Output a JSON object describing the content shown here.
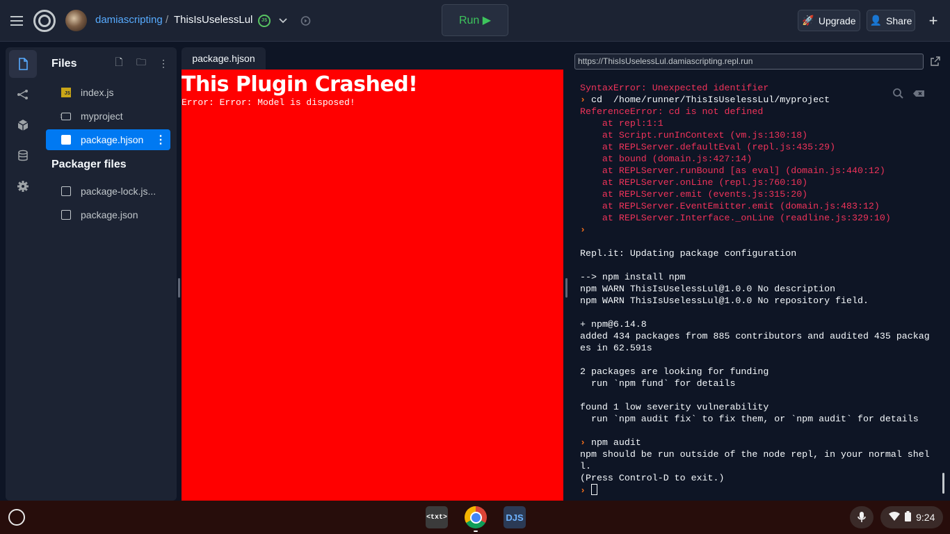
{
  "topbar": {
    "owner": "damiascripting",
    "separator": "/",
    "repl_name": "ThisIsUselessLul",
    "lang_badge": "JS",
    "run_label": "Run ▶",
    "upgrade_label": "Upgrade",
    "share_label": "Share",
    "plus_label": "+"
  },
  "sidebar": {
    "files_title": "Files",
    "packager_title": "Packager files",
    "files": [
      {
        "label": "index.js",
        "type": "js"
      },
      {
        "label": "myproject",
        "type": "folder"
      },
      {
        "label": "package.hjson",
        "type": "file",
        "selected": true
      }
    ],
    "packager_files": [
      {
        "label": "package-lock.js..."
      },
      {
        "label": "package.json"
      }
    ]
  },
  "editor": {
    "tab_label": "package.hjson",
    "crash_title": "This Plugin Crashed!",
    "crash_message": "Error: Error: Model is disposed!",
    "crash_bg": "#ff0000"
  },
  "console": {
    "url": "https://ThisIsUselessLul.damiascripting.repl.run",
    "lines": [
      {
        "k": "err",
        "t": "SyntaxError: Unexpected identifier"
      },
      {
        "k": "cmd",
        "t": "cd  /home/runner/ThisIsUselessLul/myproject"
      },
      {
        "k": "err",
        "t": "ReferenceError: cd is not defined"
      },
      {
        "k": "err",
        "t": "    at repl:1:1"
      },
      {
        "k": "err",
        "t": "    at Script.runInContext (vm.js:130:18)"
      },
      {
        "k": "err",
        "t": "    at REPLServer.defaultEval (repl.js:435:29)"
      },
      {
        "k": "err",
        "t": "    at bound (domain.js:427:14)"
      },
      {
        "k": "err",
        "t": "    at REPLServer.runBound [as eval] (domain.js:440:12)"
      },
      {
        "k": "err",
        "t": "    at REPLServer.onLine (repl.js:760:10)"
      },
      {
        "k": "err",
        "t": "    at REPLServer.emit (events.js:315:20)"
      },
      {
        "k": "err",
        "t": "    at REPLServer.EventEmitter.emit (domain.js:483:12)"
      },
      {
        "k": "err",
        "t": "    at REPLServer.Interface._onLine (readline.js:329:10)"
      },
      {
        "k": "cmd",
        "t": ""
      },
      {
        "k": "ok",
        "t": ""
      },
      {
        "k": "ok",
        "t": "Repl.it: Updating package configuration"
      },
      {
        "k": "ok",
        "t": ""
      },
      {
        "k": "ok",
        "t": "--> npm install npm"
      },
      {
        "k": "ok",
        "t": "npm WARN ThisIsUselessLul@1.0.0 No description"
      },
      {
        "k": "ok",
        "t": "npm WARN ThisIsUselessLul@1.0.0 No repository field."
      },
      {
        "k": "ok",
        "t": ""
      },
      {
        "k": "ok",
        "t": "+ npm@6.14.8"
      },
      {
        "k": "ok",
        "t": "added 434 packages from 885 contributors and audited 435 packag"
      },
      {
        "k": "ok",
        "t": "es in 62.591s"
      },
      {
        "k": "ok",
        "t": ""
      },
      {
        "k": "ok",
        "t": "2 packages are looking for funding"
      },
      {
        "k": "ok",
        "t": "  run `npm fund` for details"
      },
      {
        "k": "ok",
        "t": ""
      },
      {
        "k": "ok",
        "t": "found 1 low severity vulnerability"
      },
      {
        "k": "ok",
        "t": "  run `npm audit fix` to fix them, or `npm audit` for details"
      },
      {
        "k": "ok",
        "t": ""
      },
      {
        "k": "cmd",
        "t": "npm audit"
      },
      {
        "k": "ok",
        "t": "npm should be run outside of the node repl, in your normal shel"
      },
      {
        "k": "ok",
        "t": "l."
      },
      {
        "k": "ok",
        "t": "(Press Control-D to exit.)"
      },
      {
        "k": "input",
        "t": ""
      }
    ]
  },
  "shelf": {
    "apps": [
      {
        "name": "text-app",
        "label": "<txt>"
      },
      {
        "name": "chrome-app",
        "label": ""
      },
      {
        "name": "djs-app",
        "label": "DJS"
      }
    ],
    "time": "9:24"
  },
  "colors": {
    "accent": "#0079f2",
    "error": "#f0335a",
    "run": "#3dc45c",
    "prompt": "#f26d1a"
  }
}
